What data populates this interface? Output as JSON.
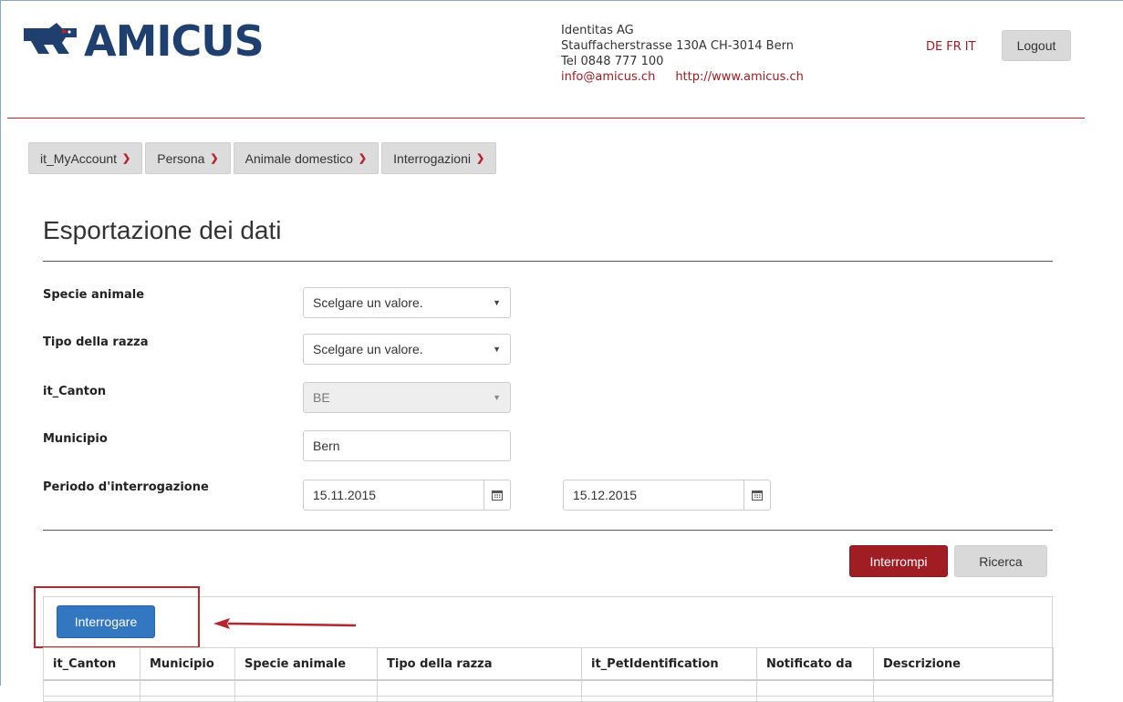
{
  "brand": {
    "name": "AMICUS",
    "color": "#1f3f6e"
  },
  "company": {
    "name": "Identitas AG",
    "address": "Stauffacherstrasse 130A CH-3014 Bern",
    "phone": "Tel 0848 777 100",
    "email": "info@amicus.ch",
    "website": "http://www.amicus.ch"
  },
  "languages": [
    "DE",
    "FR",
    "IT"
  ],
  "logout_label": "Logout",
  "nav": [
    {
      "label": "it_MyAccount"
    },
    {
      "label": "Persona"
    },
    {
      "label": "Animale domestico"
    },
    {
      "label": "Interrogazioni"
    }
  ],
  "page_title": "Esportazione dei dati",
  "form": {
    "species": {
      "label": "Specie animale",
      "value": "Scelgare un valore."
    },
    "breed_type": {
      "label": "Tipo della razza",
      "value": "Scelgare un valore."
    },
    "canton": {
      "label": "it_Canton",
      "value": "BE"
    },
    "municipality": {
      "label": "Municipio",
      "value": "Bern"
    },
    "period": {
      "label": "Periodo d'interrogazione",
      "from": "15.11.2015",
      "to": "15.12.2015"
    }
  },
  "buttons": {
    "stop": "Interrompi",
    "search": "Ricerca",
    "query": "Interrogare"
  },
  "table": {
    "headers": [
      "it_Canton",
      "Municipio",
      "Specie animale",
      "Tipo della razza",
      "it_PetIdentification",
      "Notificato da",
      "Descrizione"
    ]
  },
  "colors": {
    "accent_red": "#a11d24",
    "primary_blue": "#3377c0",
    "highlight": "#c0252c"
  }
}
